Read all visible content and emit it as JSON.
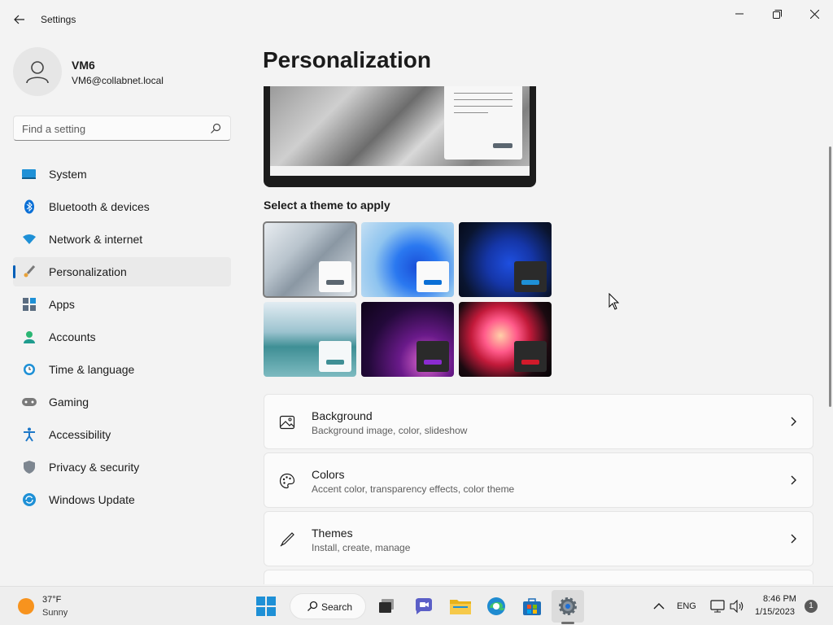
{
  "window": {
    "title": "Settings",
    "minimize_icon": "minimize-icon",
    "maximize_icon": "restore-icon",
    "close_icon": "close-icon"
  },
  "profile": {
    "name": "VM6",
    "email": "VM6@collabnet.local"
  },
  "search": {
    "placeholder": "Find a setting"
  },
  "sidebar": {
    "items": [
      {
        "label": "System",
        "icon": "system-icon"
      },
      {
        "label": "Bluetooth & devices",
        "icon": "bluetooth-icon"
      },
      {
        "label": "Network & internet",
        "icon": "wifi-icon"
      },
      {
        "label": "Personalization",
        "icon": "brush-icon",
        "active": true
      },
      {
        "label": "Apps",
        "icon": "apps-icon"
      },
      {
        "label": "Accounts",
        "icon": "accounts-icon"
      },
      {
        "label": "Time & language",
        "icon": "clock-icon"
      },
      {
        "label": "Gaming",
        "icon": "gamepad-icon"
      },
      {
        "label": "Accessibility",
        "icon": "accessibility-icon"
      },
      {
        "label": "Privacy & security",
        "icon": "shield-icon"
      },
      {
        "label": "Windows Update",
        "icon": "update-icon"
      }
    ]
  },
  "main": {
    "title": "Personalization",
    "themes_label": "Select a theme to apply",
    "themes": [
      {
        "name": "windows-light",
        "selected": true
      },
      {
        "name": "windows-dark-blue-light"
      },
      {
        "name": "windows-dark"
      },
      {
        "name": "glow-lake"
      },
      {
        "name": "captured-motion"
      },
      {
        "name": "flow"
      }
    ],
    "cards": [
      {
        "title": "Background",
        "subtitle": "Background image, color, slideshow",
        "icon": "image-icon"
      },
      {
        "title": "Colors",
        "subtitle": "Accent color, transparency effects, color theme",
        "icon": "palette-icon"
      },
      {
        "title": "Themes",
        "subtitle": "Install, create, manage",
        "icon": "pen-icon"
      }
    ]
  },
  "taskbar": {
    "weather_temp": "37°F",
    "weather_condition": "Sunny",
    "search_label": "Search",
    "language": "ENG",
    "time": "8:46 PM",
    "date": "1/15/2023",
    "notification_count": "1"
  },
  "colors": {
    "accent": "#005fb8",
    "background": "#f3f3f3",
    "card": "#fbfbfb"
  }
}
